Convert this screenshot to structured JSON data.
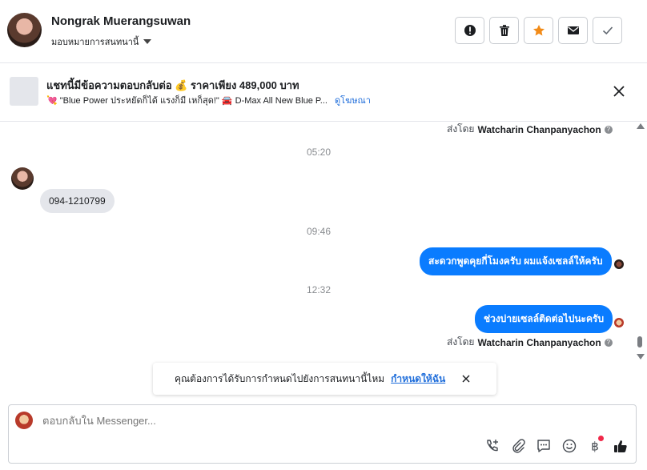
{
  "header": {
    "name": "Nongrak Muerangsuwan",
    "assign_label": "มอบหมายการสนทนานี้",
    "actions": [
      "spam-icon",
      "trash-icon",
      "star-icon",
      "envelope-icon",
      "check-icon"
    ],
    "star_color": "#f28b18"
  },
  "banner": {
    "title": "แชทนี้มีข้อความตอบกลับต่อ 💰 ราคาเพียง 489,000 บาท",
    "subtitle": "💘 \"Blue Power ประหยัดก็ได้ แรงก็มี เหก็สุด!\" 🚘 D-Max All New Blue P...",
    "link": "ดูโฆษณา"
  },
  "messages": {
    "sent_by_prefix": "ส่งโดย",
    "sent_by_name": "Watcharin Chanpanyachon",
    "times": [
      "05:20",
      "09:46",
      "12:32"
    ],
    "incoming_1": "094-1210799",
    "outgoing_1": "สะดวกพูดคุยกี่โมงครับ ผมแจ้งเซลล์ให้ครับ",
    "outgoing_2": "ช่วงบ่ายเซลล์ติดต่อไปนะครับ"
  },
  "prompt": {
    "text": "คุณต้องการได้รับการกำหนดไปยังการสนทนานี้ไหม",
    "link": "กำหนดให้ฉัน"
  },
  "composer": {
    "placeholder": "ตอบกลับใน Messenger...",
    "tools": [
      "phone-add-icon",
      "paperclip-icon",
      "saved-reply-icon",
      "emoji-icon",
      "baht-icon",
      "thumbs-up-icon"
    ],
    "accent": "#0a7cff"
  }
}
